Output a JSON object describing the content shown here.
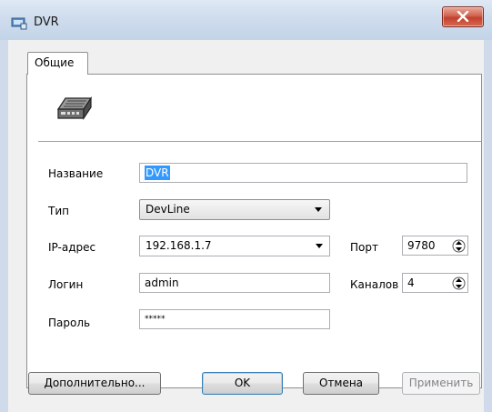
{
  "window": {
    "title": "DVR"
  },
  "tabs": [
    {
      "label": "Общие"
    }
  ],
  "form": {
    "name_label": "Название",
    "name_value": "DVR",
    "type_label": "Тип",
    "type_value": "DevLine",
    "ip_label": "IP-адрес",
    "ip_value": "192.168.1.7",
    "port_label": "Порт",
    "port_value": "9780",
    "login_label": "Логин",
    "login_value": "admin",
    "channels_label": "Каналов",
    "channels_value": "4",
    "password_label": "Пароль",
    "password_value": "*****"
  },
  "buttons": {
    "advanced": "Дополнительно...",
    "ok": "OK",
    "cancel": "Отмена",
    "apply": "Применить"
  }
}
